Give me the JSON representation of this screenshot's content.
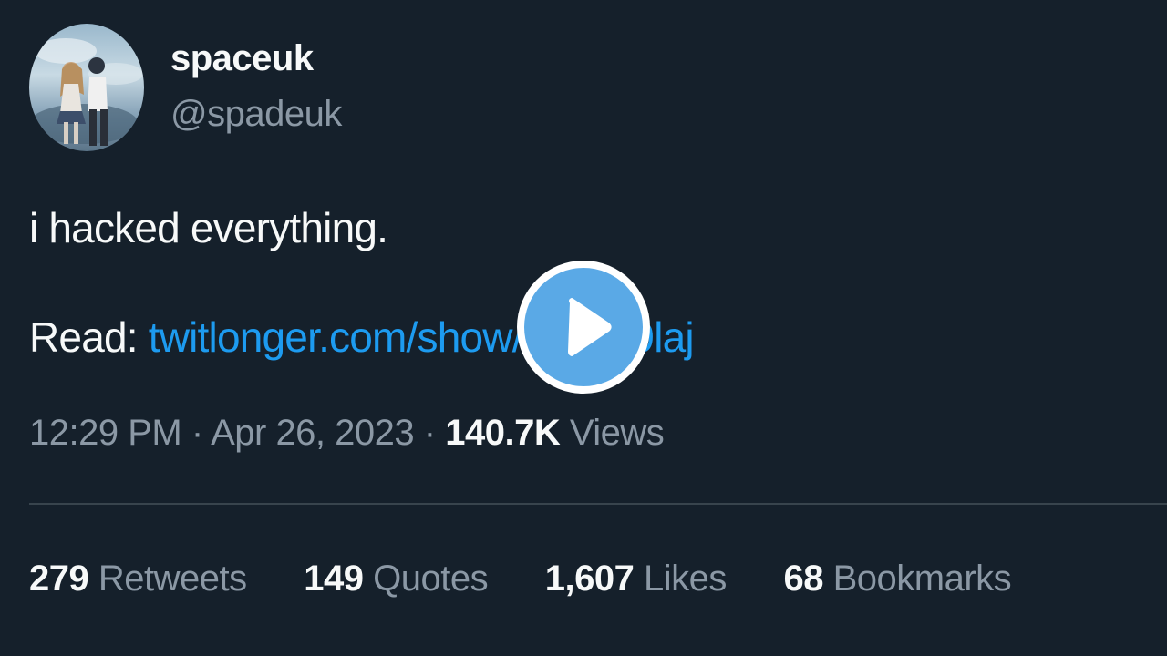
{
  "author": {
    "display_name": "spaceuk",
    "handle": "@spadeuk"
  },
  "tweet": {
    "text": "i hacked everything.",
    "read_label": "Read:",
    "link_text": "twitlonger.com/show/n_1sv9laj",
    "time": "12:29 PM",
    "separator": "·",
    "date": "Apr 26, 2023",
    "views_count": "140.7K",
    "views_label": "Views"
  },
  "stats": [
    {
      "count": "279",
      "label": "Retweets"
    },
    {
      "count": "149",
      "label": "Quotes"
    },
    {
      "count": "1,607",
      "label": "Likes"
    },
    {
      "count": "68",
      "label": "Bookmarks"
    }
  ],
  "icons": {
    "play": "play-icon"
  },
  "colors": {
    "background": "#15202b",
    "text_primary": "#f7f9f9",
    "text_secondary": "#8b98a5",
    "link": "#1d9bf0",
    "play_fill": "#5aa9e6"
  }
}
